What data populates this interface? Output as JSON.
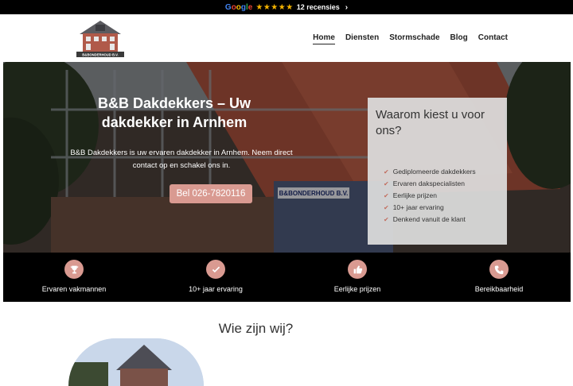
{
  "topbar": {
    "brand": "Google",
    "stars": "★★★★★",
    "reviews_label": "12 recensies",
    "chevron": "›"
  },
  "header": {
    "logo_text": "B&BONDERHOUD B.V.",
    "nav": [
      {
        "label": "Home",
        "active": true
      },
      {
        "label": "Diensten"
      },
      {
        "label": "Stormschade"
      },
      {
        "label": "Blog"
      },
      {
        "label": "Contact"
      }
    ]
  },
  "hero": {
    "title": "B&B Dakdekkers – Uw dakdekker in Arnhem",
    "text": "B&B Dakdekkers is uw ervaren dakdekker in Arnhem. Neem direct contact op en schakel ons in.",
    "button_label": "Bel 026-7820116",
    "van_sign": "B&BONDERHOUD B.V.",
    "why": {
      "title": "Waarom kiest u voor ons?",
      "items": [
        "Gediplomeerde dakdekkers",
        "Ervaren dakspecialisten",
        "Eerlijke prijzen",
        "10+ jaar ervaring",
        "Denkend vanuit de klant"
      ]
    }
  },
  "features": [
    {
      "icon": "trophy-icon",
      "label": "Ervaren vakmannen"
    },
    {
      "icon": "check-icon",
      "label": "10+ jaar ervaring"
    },
    {
      "icon": "thumbs-up-icon",
      "label": "Eerlijke prijzen"
    },
    {
      "icon": "phone-icon",
      "label": "Bereikbaarheid"
    }
  ],
  "about": {
    "title": "Wie zijn wij?"
  },
  "colors": {
    "accent": "#d99a91",
    "dark": "#000000",
    "star": "#f5b400"
  }
}
